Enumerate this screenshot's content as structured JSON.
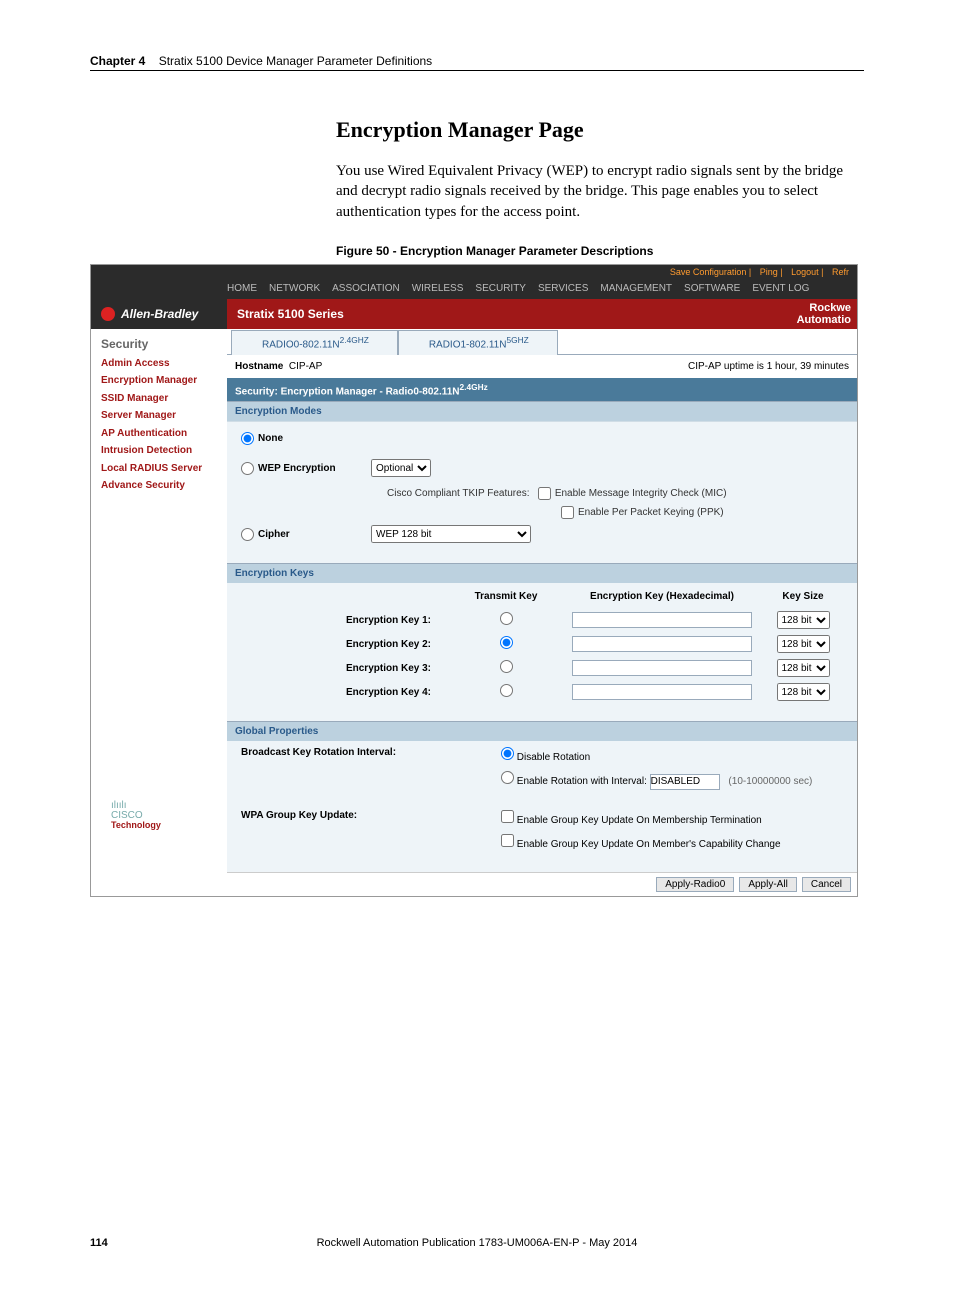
{
  "chapter": {
    "label": "Chapter 4",
    "title": "Stratix 5100 Device Manager Parameter Definitions"
  },
  "section_title": "Encryption Manager Page",
  "body_text": "You use Wired Equivalent Privacy (WEP) to encrypt radio signals sent by the bridge and decrypt radio signals received by the bridge. This page enables you to select authentication types for the access point.",
  "figure_caption": "Figure 50 - Encryption Manager Parameter Descriptions",
  "util_links": {
    "save": "Save Configuration",
    "ping": "Ping",
    "logout": "Logout",
    "refresh": "Refr"
  },
  "nav": {
    "home": "HOME",
    "network": "NETWORK",
    "association": "ASSOCIATION",
    "wireless": "WIRELESS",
    "security": "SECURITY",
    "services": "SERVICES",
    "management": "MANAGEMENT",
    "software": "SOFTWARE",
    "eventlog": "EVENT LOG"
  },
  "brand": {
    "left": "Allen-Bradley",
    "series": "Stratix 5100 Series",
    "right1": "Rockwe",
    "right2": "Automatio"
  },
  "sidebar": {
    "title": "Security",
    "items": [
      "Admin Access",
      "Encryption Manager",
      "SSID Manager",
      "Server Manager",
      "AP Authentication",
      "Intrusion Detection",
      "Local RADIUS Server",
      "Advance Security"
    ]
  },
  "tabs": {
    "r0": "RADIO0-802.11N",
    "r0_sup": "2.4GHZ",
    "r1": "RADIO1-802.11N",
    "r1_sup": "5GHZ"
  },
  "host": {
    "label": "Hostname",
    "name": "CIP-AP",
    "uptime": "CIP-AP uptime is 1 hour, 39 minutes"
  },
  "crumb": "Security: Encryption Manager - Radio0-802.11N",
  "crumb_sup": "2.4GHz",
  "modes": {
    "title": "Encryption Modes",
    "none": "None",
    "wep": "WEP Encryption",
    "wep_select": "Optional",
    "tkip_label": "Cisco Compliant TKIP Features:",
    "mic": "Enable Message Integrity Check (MIC)",
    "ppk": "Enable Per Packet Keying (PPK)",
    "cipher": "Cipher",
    "cipher_select": "WEP 128 bit"
  },
  "keys": {
    "title": "Encryption Keys",
    "col_transmit": "Transmit Key",
    "col_hex": "Encryption Key (Hexadecimal)",
    "col_size": "Key Size",
    "rows": [
      {
        "label": "Encryption Key 1:",
        "size": "128 bit"
      },
      {
        "label": "Encryption Key 2:",
        "size": "128 bit"
      },
      {
        "label": "Encryption Key 3:",
        "size": "128 bit"
      },
      {
        "label": "Encryption Key 4:",
        "size": "128 bit"
      }
    ]
  },
  "global": {
    "title": "Global Properties",
    "bkri_label": "Broadcast Key Rotation Interval:",
    "disable": "Disable Rotation",
    "enable_prefix": "Enable Rotation with Interval:",
    "enable_value": "DISABLED",
    "enable_hint": "(10-10000000 sec)",
    "wpa_label": "WPA Group Key Update:",
    "wpa1": "Enable Group Key Update On Membership Termination",
    "wpa2": "Enable Group Key Update On Member's Capability Change"
  },
  "buttons": {
    "apply_r0": "Apply-Radio0",
    "apply_all": "Apply-All",
    "cancel": "Cancel"
  },
  "cisco": {
    "dots": "ılıılı",
    "name": "CISCO",
    "tech": "Technology"
  },
  "footer": {
    "page": "114",
    "pub": "Rockwell Automation Publication 1783-UM006A-EN-P - May 2014"
  }
}
